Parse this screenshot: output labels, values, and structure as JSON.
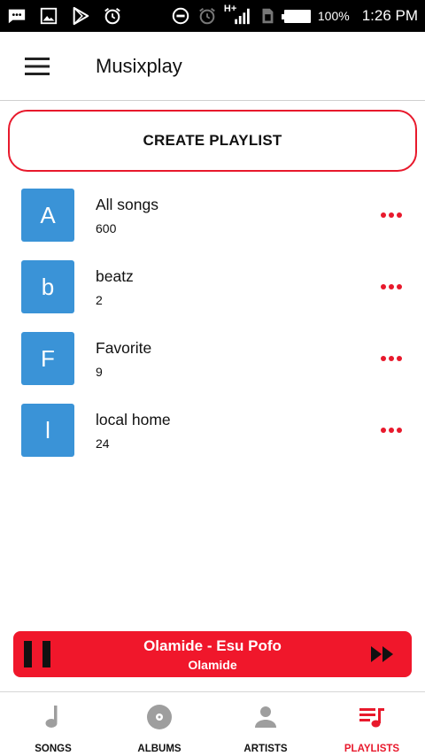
{
  "status_bar": {
    "signal_label": "H+",
    "battery_percent": "100%",
    "time": "1:26 PM",
    "icons": [
      "chat-icon",
      "image-icon",
      "play-store-icon",
      "alarm-icon",
      "dnd-icon",
      "alarm-icon",
      "signal-icon",
      "sim-icon",
      "battery-icon"
    ]
  },
  "app_bar": {
    "title": "Musixplay",
    "menu_icon": "hamburger-menu-icon"
  },
  "create_playlist": {
    "label": "CREATE PLAYLIST"
  },
  "playlists": [
    {
      "letter": "A",
      "name": "All songs",
      "count": "600"
    },
    {
      "letter": "b",
      "name": "beatz",
      "count": "2"
    },
    {
      "letter": "F",
      "name": "Favorite",
      "count": "9"
    },
    {
      "letter": "l",
      "name": "local home",
      "count": "24"
    }
  ],
  "now_playing": {
    "title": "Olamide - Esu Pofo",
    "artist": "Olamide",
    "state_icon": "pause-icon",
    "next_icon": "fast-forward-icon"
  },
  "bottom_nav": {
    "tabs": [
      {
        "label": "SONGS",
        "icon": "music-note-icon",
        "active": false
      },
      {
        "label": "ALBUMS",
        "icon": "album-disc-icon",
        "active": false
      },
      {
        "label": "ARTISTS",
        "icon": "person-icon",
        "active": false
      },
      {
        "label": "PLAYLISTS",
        "icon": "playlist-icon",
        "active": true
      }
    ]
  },
  "colors": {
    "accent": "#e8192c",
    "avatar": "#3a93d7",
    "now_playing_bg": "#f0172b",
    "inactive_icon": "#9e9e9e"
  }
}
